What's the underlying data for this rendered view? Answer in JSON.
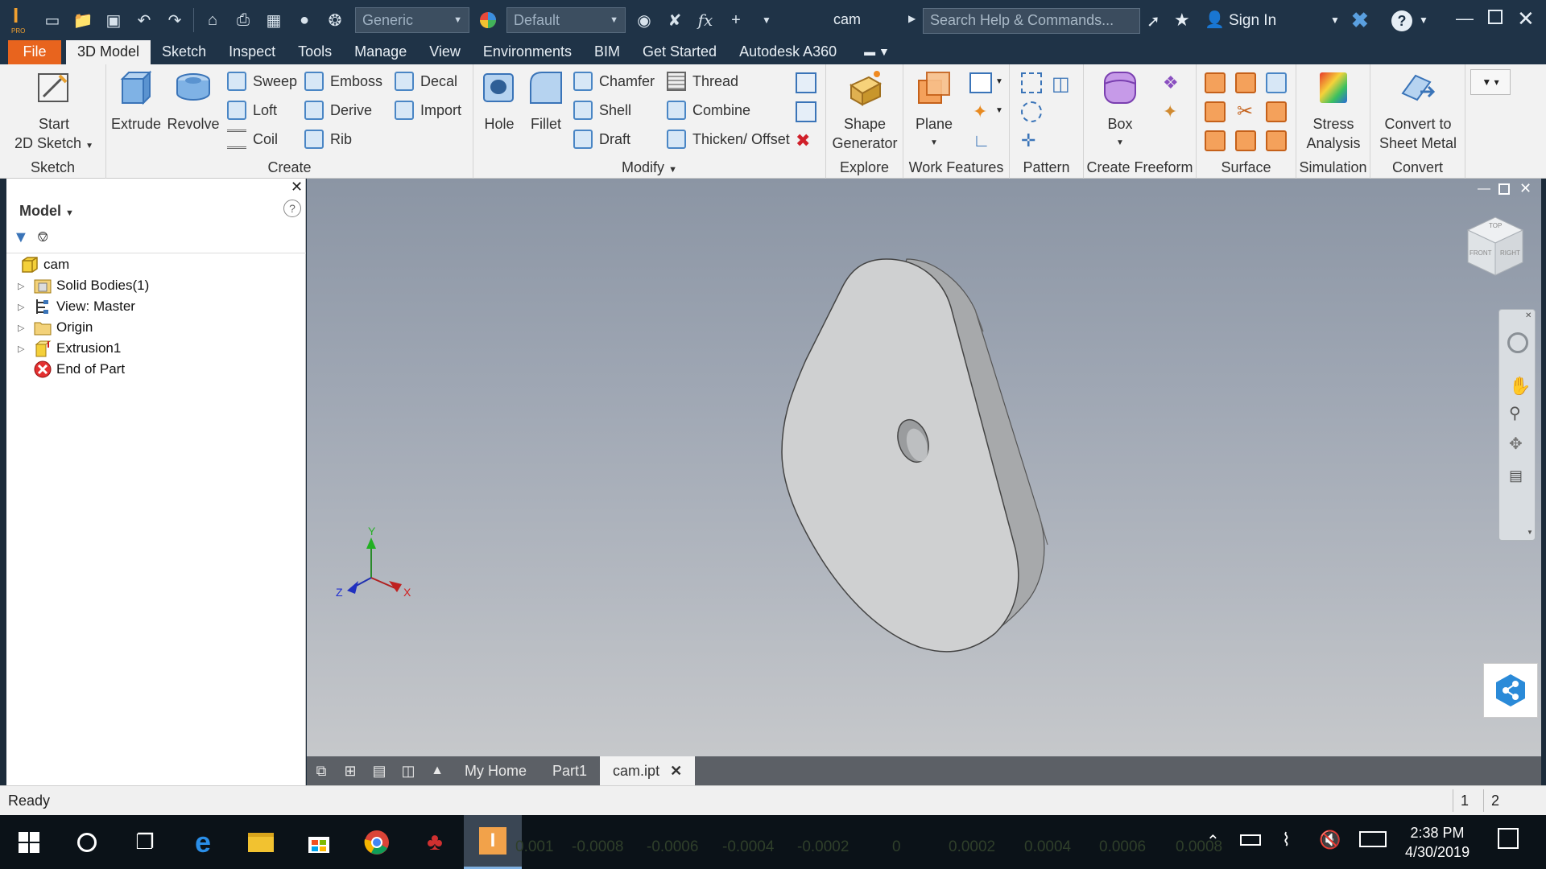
{
  "titlebar": {
    "app_logo_label": "I",
    "app_logo_sub": "PRO",
    "material_select": "Generic",
    "appearance_select": "Default",
    "fx_label": "fx",
    "document_title": "cam",
    "search_placeholder": "Search Help & Commands...",
    "sign_in": "Sign In",
    "help_label": "?"
  },
  "menu": {
    "tabs": [
      "File",
      "3D Model",
      "Sketch",
      "Inspect",
      "Tools",
      "Manage",
      "View",
      "Environments",
      "BIM",
      "Get Started",
      "Autodesk A360"
    ],
    "active": "3D Model"
  },
  "ribbon": {
    "sketch_panel": {
      "title": "Sketch",
      "start_line1": "Start",
      "start_line2": "2D Sketch"
    },
    "create_panel": {
      "title": "Create",
      "extrude": "Extrude",
      "revolve": "Revolve",
      "sweep": "Sweep",
      "loft": "Loft",
      "coil": "Coil",
      "emboss": "Emboss",
      "derive": "Derive",
      "rib": "Rib",
      "decal": "Decal",
      "import": "Import"
    },
    "modify_panel": {
      "title": "Modify",
      "hole": "Hole",
      "fillet": "Fillet",
      "chamfer": "Chamfer",
      "shell": "Shell",
      "draft": "Draft",
      "thread": "Thread",
      "combine": "Combine",
      "thicken": "Thicken/ Offset"
    },
    "explore_panel": {
      "title": "Explore",
      "shape_line1": "Shape",
      "shape_line2": "Generator"
    },
    "work_features_panel": {
      "title": "Work Features",
      "plane": "Plane"
    },
    "pattern_panel": {
      "title": "Pattern"
    },
    "freeform_panel": {
      "title": "Create Freeform",
      "box": "Box"
    },
    "surface_panel": {
      "title": "Surface"
    },
    "simulation_panel": {
      "title": "Simulation",
      "stress_line1": "Stress",
      "stress_line2": "Analysis"
    },
    "convert_panel": {
      "title": "Convert",
      "convert_line1": "Convert to",
      "convert_line2": "Sheet Metal"
    }
  },
  "browser": {
    "title": "Model",
    "help": "?",
    "tree": [
      {
        "label": "cam"
      },
      {
        "label": "Solid Bodies(1)"
      },
      {
        "label": "View: Master"
      },
      {
        "label": "Origin"
      },
      {
        "label": "Extrusion1"
      },
      {
        "label": "End of Part"
      }
    ]
  },
  "viewport": {
    "viewcube_top": "TOP",
    "viewcube_front": "FRONT",
    "viewcube_right": "RIGHT",
    "axis_x": "X",
    "axis_y": "Y",
    "axis_z": "Z"
  },
  "doc_tabs": {
    "my_home": "My Home",
    "part1": "Part1",
    "cam": "cam.ipt"
  },
  "status": {
    "text": "Ready",
    "count1": "1",
    "count2": "2"
  },
  "taskbar": {
    "time": "2:38 PM",
    "date": "4/30/2019",
    "background_numbers": [
      "0.001",
      "-0.0008",
      "-0.0006",
      "-0.0004",
      "-0.0002",
      "0",
      "0.0002",
      "0.0004",
      "0.0006",
      "0.0008"
    ]
  }
}
